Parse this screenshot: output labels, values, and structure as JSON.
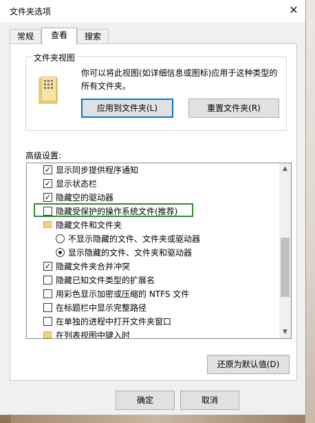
{
  "window": {
    "title": "文件夹选项",
    "close_glyph": "✕"
  },
  "tabs": [
    {
      "label": "常规"
    },
    {
      "label": "查看"
    },
    {
      "label": "搜索"
    }
  ],
  "folder_view": {
    "group_label": "文件夹视图",
    "description": "你可以将此视图(如详细信息或图标)应用于这种类型的所有文件夹。",
    "apply_button": "应用到文件夹(L)",
    "reset_button": "重置文件夹(R)"
  },
  "advanced": {
    "label": "高级设置:",
    "items": [
      {
        "type": "checkbox",
        "checked": true,
        "label": "显示同步提供程序通知"
      },
      {
        "type": "checkbox",
        "checked": true,
        "label": "显示状态栏"
      },
      {
        "type": "checkbox",
        "checked": true,
        "label": "隐藏空的驱动器"
      },
      {
        "type": "checkbox",
        "checked": false,
        "label": "隐藏受保护的操作系统文件(推荐)"
      },
      {
        "type": "folder",
        "label": "隐藏文件和文件夹"
      },
      {
        "type": "radio",
        "checked": false,
        "label": "不显示隐藏的文件、文件夹或驱动器"
      },
      {
        "type": "radio",
        "checked": true,
        "label": "显示隐藏的文件、文件夹和驱动器"
      },
      {
        "type": "checkbox",
        "checked": true,
        "label": "隐藏文件夹合并冲突"
      },
      {
        "type": "checkbox",
        "checked": false,
        "label": "隐藏已知文件类型的扩展名"
      },
      {
        "type": "checkbox",
        "checked": false,
        "label": "用彩色显示加密或压缩的 NTFS 文件"
      },
      {
        "type": "checkbox",
        "checked": false,
        "label": "在标题栏中显示完整路径"
      },
      {
        "type": "checkbox",
        "checked": false,
        "label": "在单独的进程中打开文件夹窗口"
      },
      {
        "type": "folder",
        "label": "在列表视图中键入时"
      }
    ],
    "restore_button": "还原为默认值(D)",
    "scroll_up": "▲",
    "scroll_down": "▼"
  },
  "footer": {
    "ok_button": "确定",
    "cancel_button": "取消"
  },
  "colors": {
    "highlight_box": "#2e8b2e",
    "default_button_border": "#0078d7"
  }
}
